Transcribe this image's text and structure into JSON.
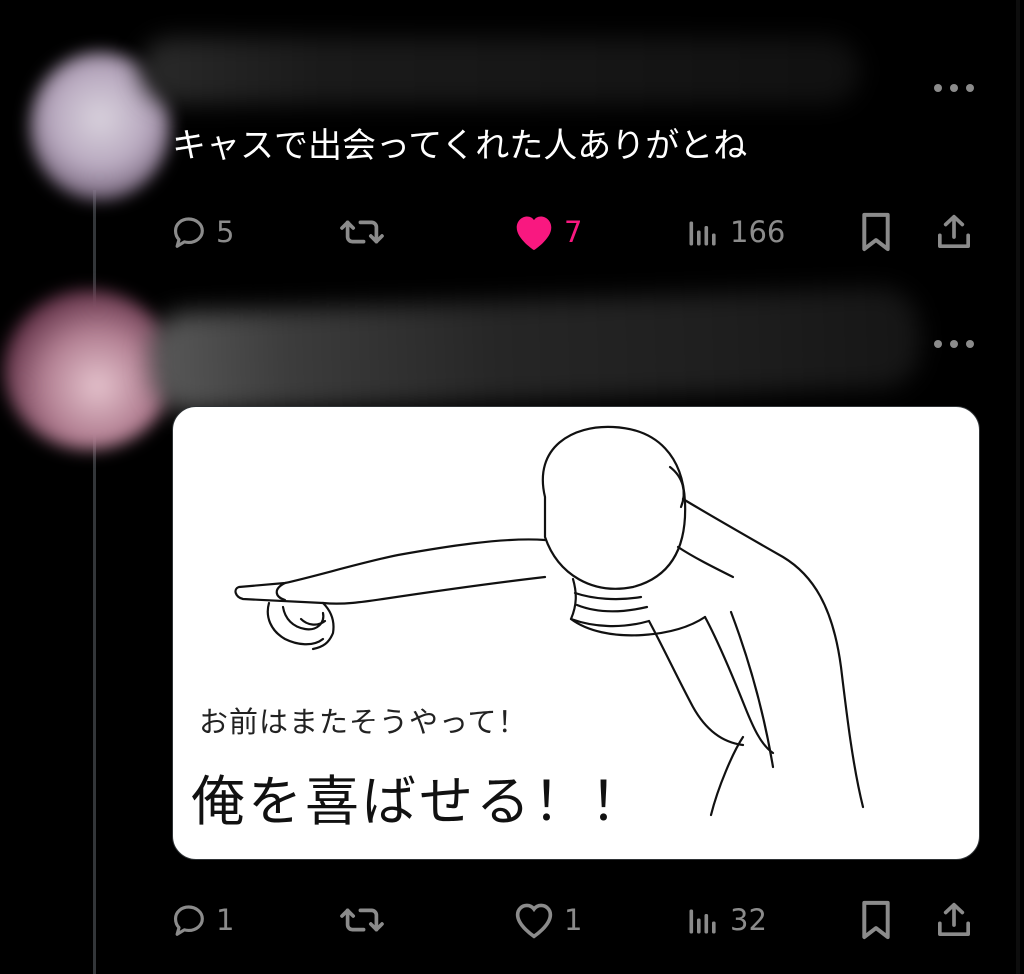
{
  "tweets": [
    {
      "text": "キャスで出会ってくれた人ありがとね",
      "replies": "5",
      "likes": "7",
      "views": "166",
      "liked": true
    },
    {
      "media": {
        "caption_small": "お前はまたそうやって！",
        "caption_big": "俺を喜ばせる！！"
      },
      "replies": "1",
      "likes": "1",
      "views": "32",
      "liked": false
    }
  ],
  "colors": {
    "like_active": "#f91880",
    "icon_gray": "#8b8b8b"
  },
  "icons": [
    "reply-icon",
    "retweet-icon",
    "heart-icon",
    "views-icon",
    "bookmark-icon",
    "share-icon",
    "more-icon"
  ]
}
